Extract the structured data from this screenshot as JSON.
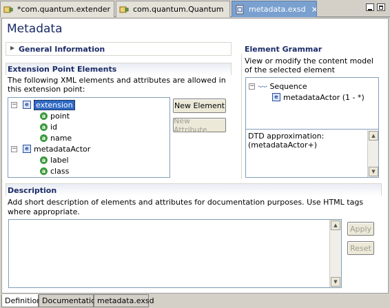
{
  "tabs": [
    {
      "label": "*com.quantum.extender",
      "active": false
    },
    {
      "label": "com.quantum.Quantum",
      "active": false
    },
    {
      "label": "metadata.exsd",
      "active": true
    }
  ],
  "page_title": "Metadata",
  "general_information": {
    "title": "General Information"
  },
  "extension_point_elements": {
    "title": "Extension Point Elements",
    "description": "The following XML elements and attributes are allowed in this extension point:",
    "tree": [
      {
        "name": "extension",
        "selected": true,
        "children": [
          "point",
          "id",
          "name"
        ]
      },
      {
        "name": "metadataActor",
        "selected": false,
        "children": [
          "label",
          "class"
        ]
      }
    ],
    "new_element_label": "New Element",
    "new_attribute_label": "New Attribute"
  },
  "element_grammar": {
    "title": "Element Grammar",
    "description": "View or modify the content model of the selected element",
    "sequence_label": "Sequence",
    "sequence_child": "metadataActor (1 - *)",
    "dtd_label": "DTD approximation:",
    "dtd_value": "(metadataActor+)"
  },
  "description_section": {
    "title": "Description",
    "text": "Add short description of elements and attributes for documentation purposes. Use HTML tags where appropriate.",
    "apply_label": "Apply",
    "reset_label": "Reset"
  },
  "bottom_tabs": [
    {
      "label": "Definition",
      "active": true
    },
    {
      "label": "Documentation",
      "active": false
    },
    {
      "label": "metadata.exsd",
      "active": false
    }
  ],
  "colors": {
    "accent": "#316ac5",
    "heading": "#1a2b66",
    "active_tab": "#7aa0cf"
  }
}
